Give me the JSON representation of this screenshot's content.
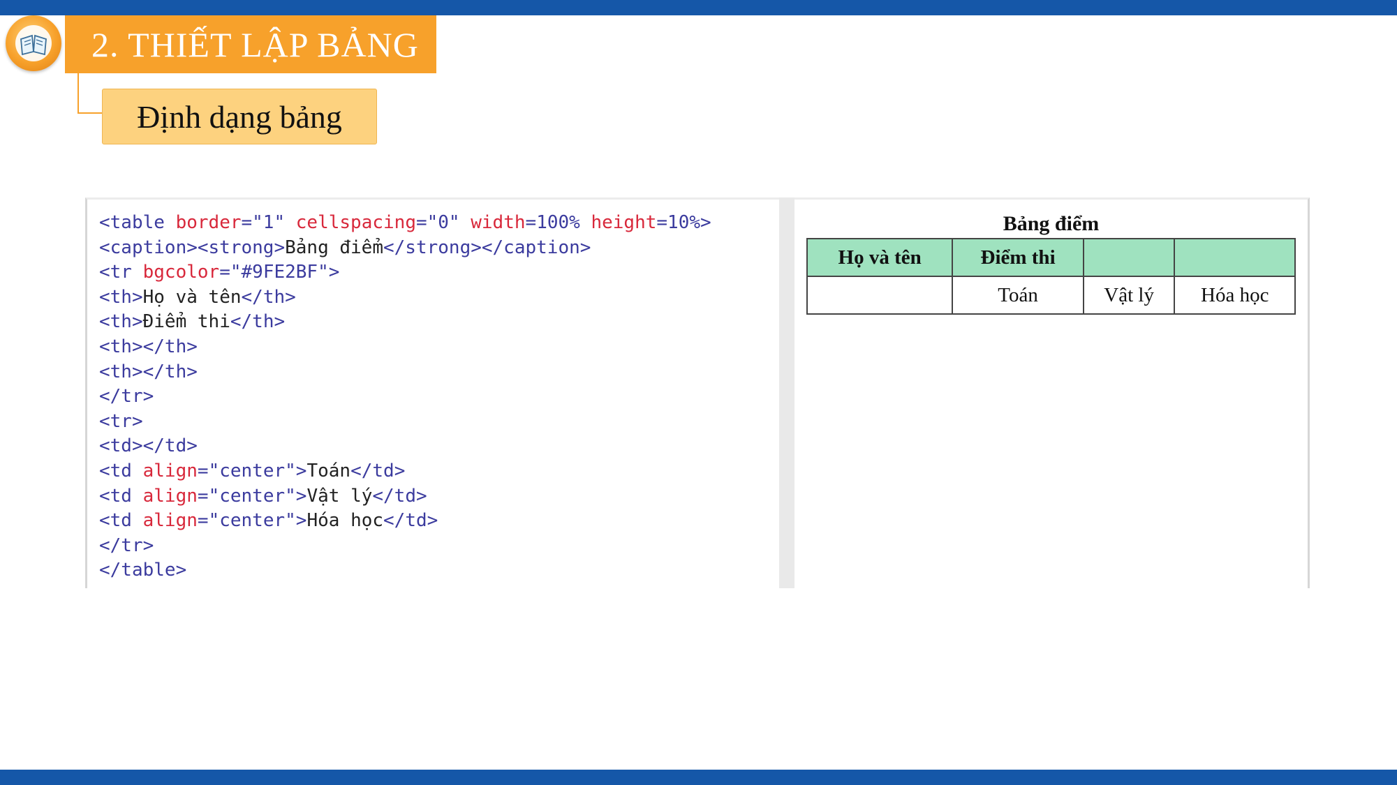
{
  "slide": {
    "title": "2. THIẾT LẬP BẢNG",
    "subtitle": "Định dạng bảng",
    "logo_icon": "book-icon",
    "colors": {
      "top_bar": "#1557a8",
      "title_bg": "#f7a12b",
      "subtitle_bg": "#fdd27f",
      "header_bg": "#9fe2bf"
    }
  },
  "code": {
    "lines": [
      [
        {
          "c": "tag",
          "t": "<table "
        },
        {
          "c": "attr",
          "t": "border"
        },
        {
          "c": "tag",
          "t": "="
        },
        {
          "c": "val",
          "t": "\"1\" "
        },
        {
          "c": "attr",
          "t": "cellspacing"
        },
        {
          "c": "tag",
          "t": "="
        },
        {
          "c": "val",
          "t": "\"0\" "
        },
        {
          "c": "attr",
          "t": "width"
        },
        {
          "c": "tag",
          "t": "="
        },
        {
          "c": "val",
          "t": "100% "
        },
        {
          "c": "attr",
          "t": "height"
        },
        {
          "c": "tag",
          "t": "="
        },
        {
          "c": "val",
          "t": "10%"
        },
        {
          "c": "tag",
          "t": ">"
        }
      ],
      [
        {
          "c": "tag",
          "t": "<caption><strong>"
        },
        {
          "c": "txt",
          "t": "Bảng điểm"
        },
        {
          "c": "tag",
          "t": "</strong></caption>"
        }
      ],
      [
        {
          "c": "tag",
          "t": "<tr "
        },
        {
          "c": "attr",
          "t": "bgcolor"
        },
        {
          "c": "tag",
          "t": "="
        },
        {
          "c": "val",
          "t": "\"#9FE2BF\""
        },
        {
          "c": "tag",
          "t": ">"
        }
      ],
      [
        {
          "c": "tag",
          "t": "<th>"
        },
        {
          "c": "txt",
          "t": "Họ và tên"
        },
        {
          "c": "tag",
          "t": "</th>"
        }
      ],
      [
        {
          "c": "tag",
          "t": "<th>"
        },
        {
          "c": "txt",
          "t": "Điểm thi"
        },
        {
          "c": "tag",
          "t": "</th>"
        }
      ],
      [
        {
          "c": "tag",
          "t": "<th></th>"
        }
      ],
      [
        {
          "c": "tag",
          "t": "<th></th>"
        }
      ],
      [
        {
          "c": "tag",
          "t": "</tr>"
        }
      ],
      [
        {
          "c": "tag",
          "t": "<tr>"
        }
      ],
      [
        {
          "c": "tag",
          "t": "<td></td>"
        }
      ],
      [
        {
          "c": "tag",
          "t": "<td "
        },
        {
          "c": "attr",
          "t": "align"
        },
        {
          "c": "tag",
          "t": "="
        },
        {
          "c": "val",
          "t": "\"center\""
        },
        {
          "c": "tag",
          "t": ">"
        },
        {
          "c": "txt",
          "t": "Toán"
        },
        {
          "c": "tag",
          "t": "</td>"
        }
      ],
      [
        {
          "c": "tag",
          "t": "<td "
        },
        {
          "c": "attr",
          "t": "align"
        },
        {
          "c": "tag",
          "t": "="
        },
        {
          "c": "val",
          "t": "\"center\""
        },
        {
          "c": "tag",
          "t": ">"
        },
        {
          "c": "txt",
          "t": "Vật lý"
        },
        {
          "c": "tag",
          "t": "</td>"
        }
      ],
      [
        {
          "c": "tag",
          "t": "<td "
        },
        {
          "c": "attr",
          "t": "align"
        },
        {
          "c": "tag",
          "t": "="
        },
        {
          "c": "val",
          "t": "\"center\""
        },
        {
          "c": "tag",
          "t": ">"
        },
        {
          "c": "txt",
          "t": "Hóa học"
        },
        {
          "c": "tag",
          "t": "</td>"
        }
      ],
      [
        {
          "c": "tag",
          "t": "</tr>"
        }
      ],
      [
        {
          "c": "tag",
          "t": "</table>"
        }
      ]
    ]
  },
  "preview": {
    "caption": "Bảng điểm",
    "headers": [
      "Họ và tên",
      "Điểm thi",
      "",
      ""
    ],
    "row": [
      "",
      "Toán",
      "Vật lý",
      "Hóa học"
    ]
  }
}
